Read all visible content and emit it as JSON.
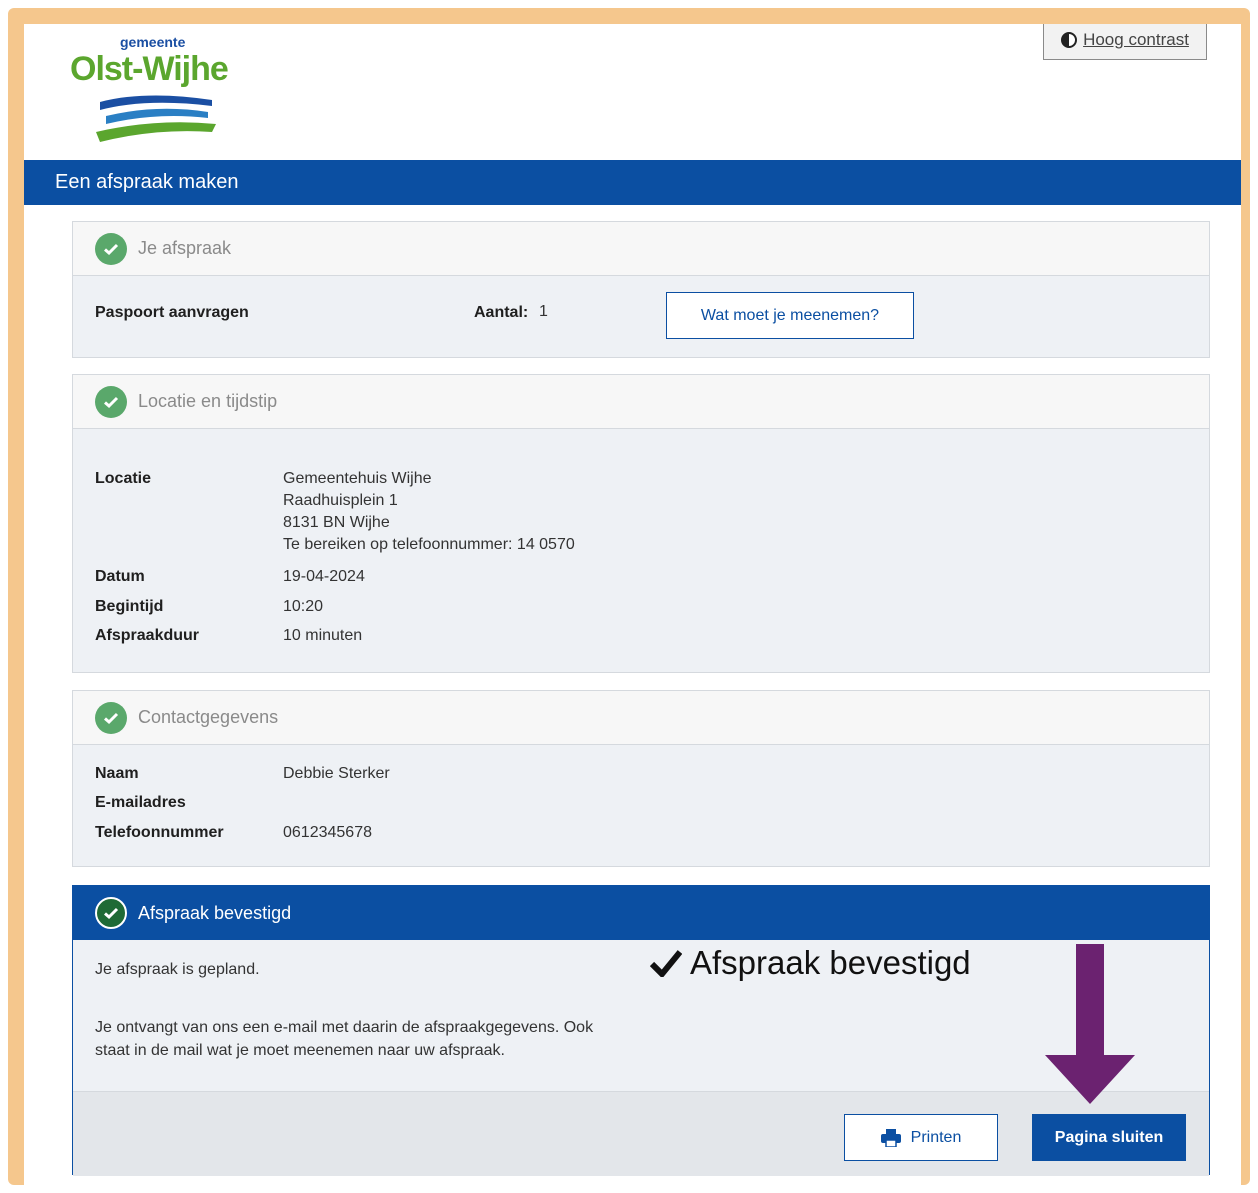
{
  "logo": {
    "small": "gemeente",
    "big": "Olst-Wijhe"
  },
  "header": {
    "contrast_label": "Hoog contrast"
  },
  "banner": {
    "title": "Een afspraak maken"
  },
  "appointment": {
    "title": "Je afspraak",
    "product": "Paspoort aanvragen",
    "count_label": "Aantal:",
    "count_value": "1",
    "bring_button": "Wat moet je meenemen?"
  },
  "location": {
    "title": "Locatie en tijdstip",
    "location_label": "Locatie",
    "address": [
      "Gemeentehuis Wijhe",
      "Raadhuisplein 1",
      "8131 BN Wijhe",
      "Te bereiken op telefoonnummer: 14 0570"
    ],
    "date_label": "Datum",
    "date_value": "19-04-2024",
    "start_label": "Begintijd",
    "start_value": "10:20",
    "duration_label": "Afspraakduur",
    "duration_value": "10 minuten"
  },
  "contact": {
    "title": "Contactgegevens",
    "name_label": "Naam",
    "name_value": "Debbie Sterker",
    "email_label": "E-mailadres",
    "email_value": "",
    "phone_label": "Telefoonnummer",
    "phone_value": "0612345678"
  },
  "confirmed": {
    "title": "Afspraak bevestigd",
    "line1": "Je afspraak is gepland.",
    "line2": "Je ontvangt van ons een e-mail met daarin de afspraakgegevens. Ook",
    "line3": "staat in de mail wat je moet meenemen naar uw afspraak.",
    "print_button": "Printen",
    "close_button": "Pagina sluiten"
  },
  "annotation": {
    "text": "Afspraak bevestigd",
    "arrow_color": "#6b2270"
  },
  "colors": {
    "brand_blue": "#0b4fa2",
    "logo_green": "#5ba62e",
    "frame": "#f5c78d",
    "success_green": "#5aa86b"
  }
}
